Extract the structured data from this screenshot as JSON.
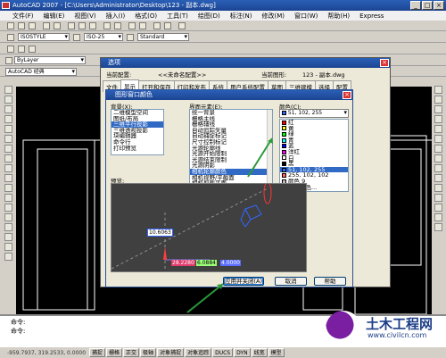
{
  "window": {
    "title": "AutoCAD 2007 - [C:\\Users\\Administrator\\Desktop\\123 - 副本.dwg]",
    "controls": [
      "_",
      "□",
      "×"
    ]
  },
  "menubar": {
    "items": [
      "文件(F)",
      "编辑(E)",
      "视图(V)",
      "插入(I)",
      "格式(O)",
      "工具(T)",
      "绘图(D)",
      "标注(N)",
      "修改(M)",
      "窗口(W)",
      "帮助(H)",
      "Express"
    ]
  },
  "toolbars": {
    "text_style": "ISOSTYLE",
    "dim_style": "ISO-25",
    "table_style": "Standard",
    "layer": "ByLayer",
    "workspace": "AutoCAD 经典"
  },
  "options_dialog": {
    "title": "选项",
    "current_profile_label": "当前配置:",
    "current_profile_value": "<<未命名配置>>",
    "current_drawing_label": "当前图形:",
    "current_drawing_value": "123 - 副本.dwg",
    "tabs": [
      "文件",
      "显示",
      "打开和保存",
      "打印和发布",
      "系统",
      "用户系统配置",
      "草图",
      "三维建模",
      "选择",
      "配置"
    ],
    "active_tab": "显示"
  },
  "color_dialog": {
    "title": "图形窗口颜色",
    "context_label": "背景(X):",
    "context_items": [
      "二维模型空间",
      "图纸/布局",
      "三维平行投影",
      "三维透视投影",
      "块编辑器",
      "命令行",
      "打印预览"
    ],
    "context_selected": 2,
    "element_label": "界面元素(E):",
    "element_items": [
      "统一背景",
      "栅格主线",
      "栅格辅线",
      "自动追踪矢量",
      "自动捕捉标记",
      "尺寸控制标记",
      "光源轮廓线",
      "光源开始限制",
      "光源结束限制",
      "光源阴影",
      "相机轮廓颜色",
      "相机视野/平截面",
      "相机剪裁平面"
    ],
    "element_selected": 10,
    "color_label": "颜色(C):",
    "color_current": "51, 102, 255",
    "color_items": [
      {
        "name": "红",
        "hex": "#ff0000"
      },
      {
        "name": "黄",
        "hex": "#ffff00"
      },
      {
        "name": "绿",
        "hex": "#00ff00"
      },
      {
        "name": "青",
        "hex": "#00ffff"
      },
      {
        "name": "蓝",
        "hex": "#0000ff"
      },
      {
        "name": "洋红",
        "hex": "#ff00ff"
      },
      {
        "name": "白",
        "hex": "#ffffff"
      },
      {
        "name": "黑",
        "hex": "#000000"
      },
      {
        "name": "51, 102, 255",
        "hex": "#3366ff"
      },
      {
        "name": "255, 102, 102",
        "hex": "#ff6666"
      },
      {
        "name": "颜色 9",
        "hex": "#c0c0c0"
      },
      {
        "name": "选择颜色...",
        "hex": "#ffffff"
      }
    ],
    "color_selected": 8,
    "preview_label": "预览:",
    "preview_values": [
      "10.6063",
      "28.2280",
      "6.0884",
      "4.0000"
    ],
    "buttons": {
      "apply_close": "应用并关闭(A)",
      "cancel": "取消",
      "help": "帮助"
    }
  },
  "command_line": {
    "lines": [
      "命令:",
      "命令:"
    ]
  },
  "status_bar": {
    "coords": "-959.7937, 319.2533, 0.0000",
    "toggles": [
      "捕捉",
      "栅格",
      "正交",
      "极轴",
      "对象捕捉",
      "对象追踪",
      "DUCS",
      "DYN",
      "线宽",
      "模型"
    ]
  },
  "watermark": {
    "title": "土木工程网",
    "url": "www.civilcn.com"
  }
}
